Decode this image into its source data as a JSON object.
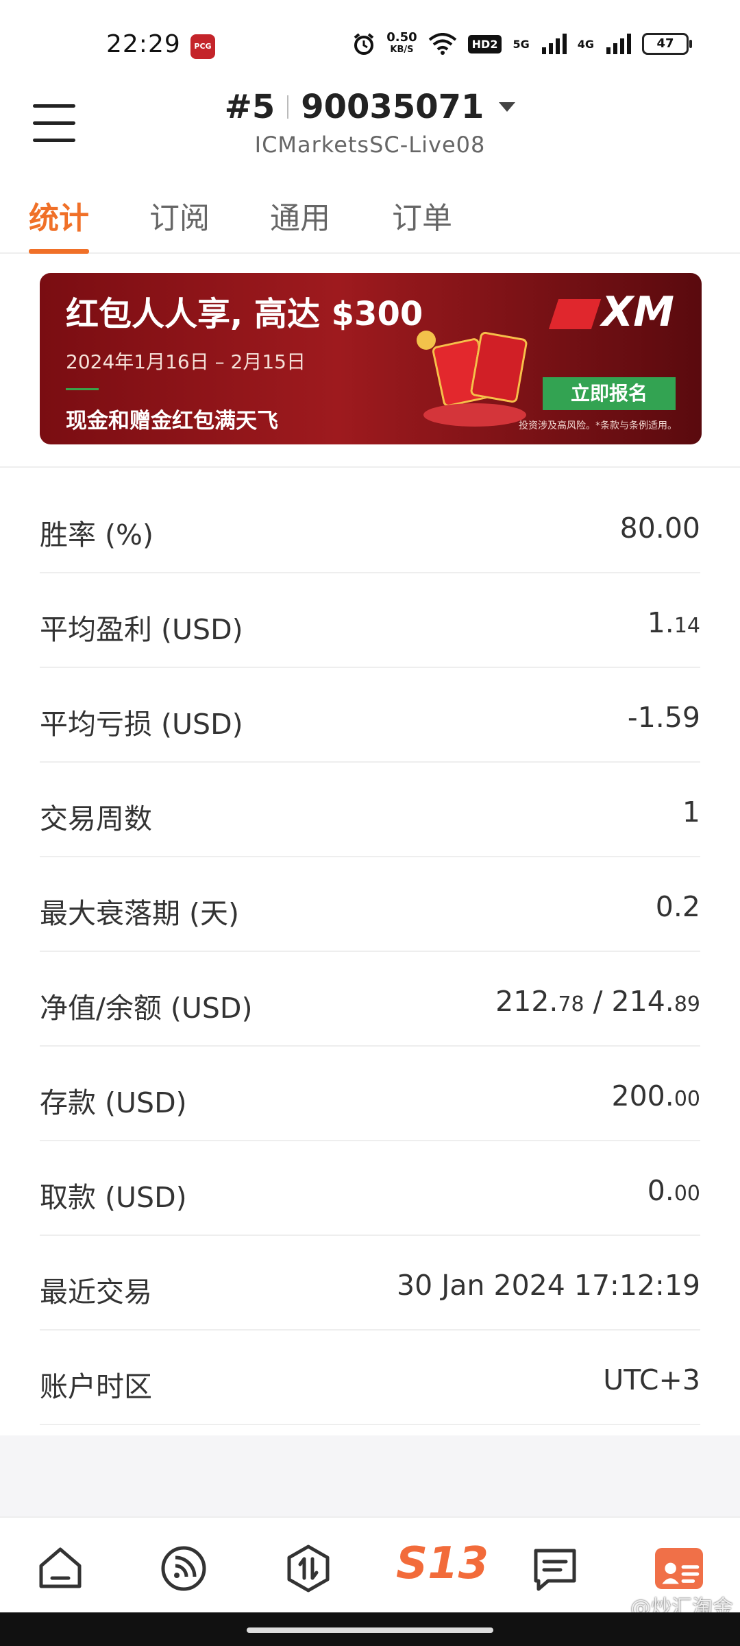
{
  "status_bar": {
    "time": "22:29",
    "app_icon_label": "PCG",
    "speed_value": "0.50",
    "speed_unit": "KB/S",
    "hd_badge": "HD2",
    "net_5g": "5G",
    "net_4g": "4G",
    "battery": "47"
  },
  "header": {
    "account_index": "#5",
    "account_number": "90035071",
    "server": "ICMarketsSC-Live08"
  },
  "tabs": [
    {
      "label": "统计",
      "active": true
    },
    {
      "label": "订阅",
      "active": false
    },
    {
      "label": "通用",
      "active": false
    },
    {
      "label": "订单",
      "active": false
    }
  ],
  "banner": {
    "headline": "红包人人享, 高达 $300",
    "date_range": "2024年1月16日 – 2月15日",
    "subline": "现金和赠金红包满天飞",
    "brand": "XM",
    "cta": "立即报名",
    "risk_note": "投资涉及高风险。*条款与条例适用。"
  },
  "stats": [
    {
      "label": "胜率 (%)",
      "value_main": "80.00",
      "value_small": ""
    },
    {
      "label": "平均盈利 (USD)",
      "value_main": "1.",
      "value_small": "14"
    },
    {
      "label": "平均亏损 (USD)",
      "value_main": "-1.59",
      "value_small": ""
    },
    {
      "label": "交易周数",
      "value_main": "1",
      "value_small": ""
    },
    {
      "label": "最大衰落期 (天)",
      "value_main": "0.2",
      "value_small": ""
    },
    {
      "label": "净值/余额 (USD)",
      "value_main": "212.",
      "value_small": "78",
      "value_main2": " / 214.",
      "value_small2": "89"
    },
    {
      "label": "存款 (USD)",
      "value_main": "200.",
      "value_small": "00"
    },
    {
      "label": "取款 (USD)",
      "value_main": "0.",
      "value_small": "00"
    },
    {
      "label": "最近交易",
      "value_main": "30 Jan 2024 17:12:19",
      "value_small": ""
    },
    {
      "label": "账户时区",
      "value_main": "UTC+3",
      "value_small": ""
    }
  ],
  "bottom_nav": {
    "items": [
      "home-icon",
      "feed-icon",
      "trade-icon",
      "s13-logo",
      "chat-icon",
      "profile-icon"
    ],
    "s13_label": "S13",
    "watermark": "@炒汇淘金"
  },
  "colors": {
    "accent": "#f07028",
    "banner_bg": "#8a1218",
    "cta_green": "#33a352"
  }
}
